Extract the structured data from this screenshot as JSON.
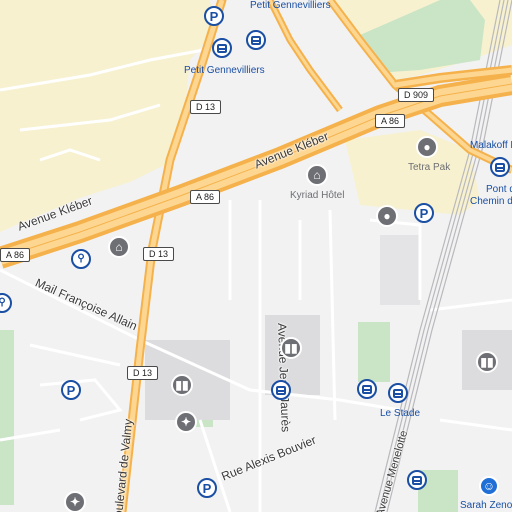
{
  "map": {
    "places": {
      "petit_gennevilliers_top": "Petit Gennevilliers",
      "petit_gennevilliers_station": "Petit Gennevilliers",
      "malakoff": "Malakoff M",
      "tetra_pak": "Tetra Pak",
      "pont_chemin_1": "Pont d",
      "pont_chemin_2": "Chemin d",
      "kyriad": "Kyriad Hôtel",
      "le_stade": "Le Stade",
      "sarah_zenou": "Sarah Zenou"
    },
    "roads": {
      "avenue_kleber_1": "Avenue Kléber",
      "avenue_kleber_2": "Avenue Kléber",
      "mail_francoise_allain": "Mail Françoise Allain",
      "avenue_jean_jaures": "Avenue Jean Jaurès",
      "rue_alexis_bouvier": "Rue Alexis Bouvier",
      "boulevard_valmy": "oulevard de Valmy",
      "avenue_menelotte": "Avenue Menelotte"
    },
    "shields": {
      "d909": "D 909",
      "a86_right": "A 86",
      "a86_mid": "A 86",
      "a86_left": "A 86",
      "d13_top": "D 13",
      "d13_mid": "D 13",
      "d13_low": "D 13"
    },
    "icons": {
      "parking": "P",
      "building": "▮▮",
      "hotel": "⌂",
      "sport": "✦",
      "bike": "⚲",
      "pin": "●",
      "person": "☺"
    },
    "colors": {
      "motorway": "#f5b24c",
      "residential": "#f7f1cf",
      "green": "#c9e5c6",
      "transit": "#1a4fa3",
      "background": "#f2f2f3"
    }
  }
}
